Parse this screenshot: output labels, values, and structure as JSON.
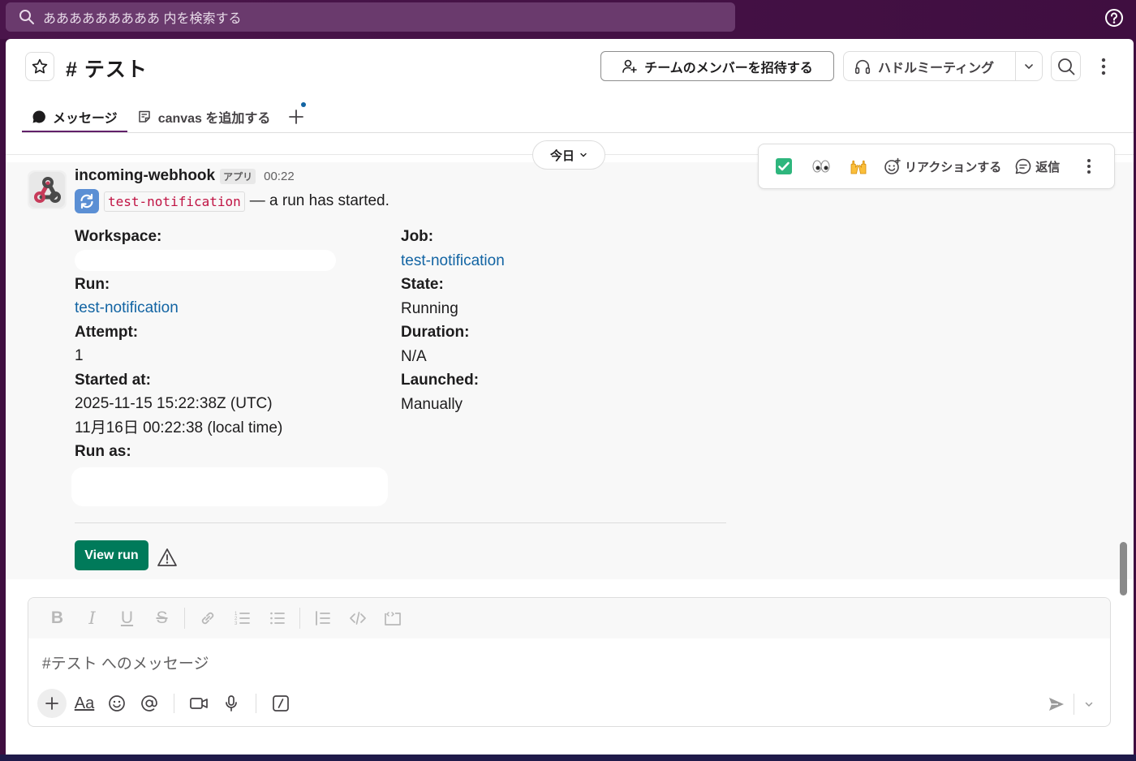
{
  "search": {
    "placeholder": "あああああああああ 内を検索する"
  },
  "header": {
    "channel_title": "# テスト",
    "invite_label": "チームのメンバーを招待する",
    "huddle_label": "ハドルミーティング"
  },
  "tabs": [
    {
      "label": "メッセージ"
    },
    {
      "label": "canvas を追加する"
    }
  ],
  "date_pill": {
    "label": "今日"
  },
  "actions": {
    "react_label": "リアクションする",
    "reply_label": "返信",
    "emojis": [
      "✅",
      "👀",
      "🙌"
    ]
  },
  "message": {
    "sender": "incoming-webhook",
    "app_badge": "アプリ",
    "time": "00:22",
    "code_text": "test-notification",
    "text": "— a run has started.",
    "fields_left": {
      "workspace_label": "Workspace:",
      "run_label": "Run:",
      "run_value": "test-notification",
      "attempt_label": "Attempt:",
      "attempt_value": "1",
      "started_label": "Started at:",
      "started_utc": "2025-11-15 15:22:38Z (UTC)",
      "started_local": "11月16日 00:22:38 (local time)",
      "runas_label": "Run as:"
    },
    "fields_right": {
      "job_label": "Job:",
      "job_value": "test-notification",
      "state_label": "State:",
      "state_value": "Running",
      "duration_label": "Duration:",
      "duration_value": "N/A",
      "launched_label": "Launched:",
      "launched_value": "Manually"
    },
    "view_run_label": "View run"
  },
  "composer": {
    "placeholder": "#テスト へのメッセージ",
    "aa_label": "Aa"
  },
  "colors": {
    "sidebar": "#3f0e40",
    "link": "#1264a3",
    "button_green": "#007a5a",
    "code_red": "#c01343",
    "tab_underline": "#611f69"
  }
}
